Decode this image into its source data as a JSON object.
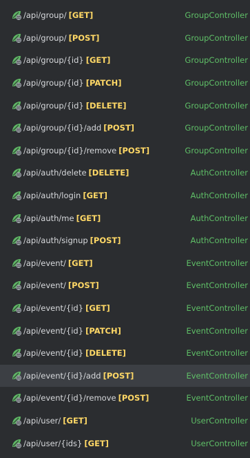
{
  "endpoints": [
    {
      "path": "/api/group/",
      "method": "[GET]",
      "controller": "GroupController",
      "icon": "endpoint-icon",
      "selected": false
    },
    {
      "path": "/api/group/",
      "method": "[POST]",
      "controller": "GroupController",
      "icon": "endpoint-icon",
      "selected": false
    },
    {
      "path": "/api/group/{id}",
      "method": "[GET]",
      "controller": "GroupController",
      "icon": "endpoint-icon",
      "selected": false
    },
    {
      "path": "/api/group/{id}",
      "method": "[PATCH]",
      "controller": "GroupController",
      "icon": "endpoint-icon",
      "selected": false
    },
    {
      "path": "/api/group/{id}",
      "method": "[DELETE]",
      "controller": "GroupController",
      "icon": "endpoint-icon",
      "selected": false
    },
    {
      "path": "/api/group/{id}/add",
      "method": "[POST]",
      "controller": "GroupController",
      "icon": "endpoint-icon",
      "selected": false
    },
    {
      "path": "/api/group/{id}/remove",
      "method": "[POST]",
      "controller": "GroupController",
      "icon": "endpoint-icon",
      "selected": false
    },
    {
      "path": "/api/auth/delete",
      "method": "[DELETE]",
      "controller": "AuthController",
      "icon": "endpoint-icon",
      "selected": false
    },
    {
      "path": "/api/auth/login",
      "method": "[GET]",
      "controller": "AuthController",
      "icon": "endpoint-icon",
      "selected": false
    },
    {
      "path": "/api/auth/me",
      "method": "[GET]",
      "controller": "AuthController",
      "icon": "endpoint-icon",
      "selected": false
    },
    {
      "path": "/api/auth/signup",
      "method": "[POST]",
      "controller": "AuthController",
      "icon": "endpoint-icon",
      "selected": false
    },
    {
      "path": "/api/event/",
      "method": "[GET]",
      "controller": "EventController",
      "icon": "endpoint-icon",
      "selected": false
    },
    {
      "path": "/api/event/",
      "method": "[POST]",
      "controller": "EventController",
      "icon": "endpoint-icon",
      "selected": false
    },
    {
      "path": "/api/event/{id}",
      "method": "[GET]",
      "controller": "EventController",
      "icon": "endpoint-icon",
      "selected": false
    },
    {
      "path": "/api/event/{id}",
      "method": "[PATCH]",
      "controller": "EventController",
      "icon": "endpoint-icon",
      "selected": false
    },
    {
      "path": "/api/event/{id}",
      "method": "[DELETE]",
      "controller": "EventController",
      "icon": "endpoint-icon",
      "selected": false
    },
    {
      "path": "/api/event/{id}/add",
      "method": "[POST]",
      "controller": "EventController",
      "icon": "endpoint-icon",
      "selected": true
    },
    {
      "path": "/api/event/{id}/remove",
      "method": "[POST]",
      "controller": "EventController",
      "icon": "endpoint-icon",
      "selected": false
    },
    {
      "path": "/api/user/",
      "method": "[GET]",
      "controller": "UserController",
      "icon": "endpoint-icon",
      "selected": false
    },
    {
      "path": "/api/user/{ids}",
      "method": "[GET]",
      "controller": "UserController",
      "icon": "endpoint-icon",
      "selected": false
    }
  ],
  "colors": {
    "background": "#2b2d30",
    "selected_row": "#3c3f44",
    "path_text": "#d7d9dc",
    "method_text": "#ffd866",
    "controller_text": "#5fbf67",
    "icon_leaf": "#5fb865",
    "icon_globe": "#aeb3bb"
  }
}
